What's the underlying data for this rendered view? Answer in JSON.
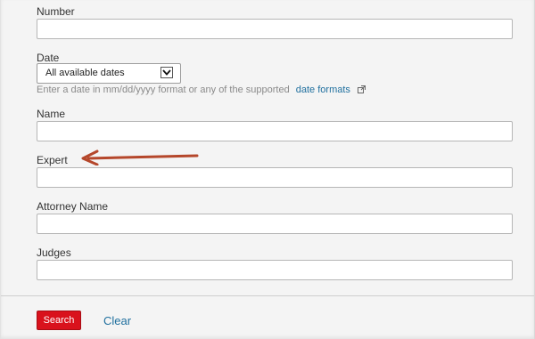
{
  "form": {
    "number": {
      "label": "Number",
      "value": ""
    },
    "date": {
      "label": "Date",
      "selected": "All available dates",
      "hint_text": "Enter a date in mm/dd/yyyy format or any of the supported",
      "hint_link": "date formats",
      "external_icon": "external-link-icon"
    },
    "name": {
      "label": "Name",
      "value": ""
    },
    "expert": {
      "label": "Expert",
      "value": ""
    },
    "attorney_name": {
      "label": "Attorney Name",
      "value": ""
    },
    "judges": {
      "label": "Judges",
      "value": ""
    }
  },
  "actions": {
    "search_label": "Search",
    "clear_label": "Clear"
  },
  "colors": {
    "search_button": "#d9121c",
    "link": "#1f6f9e",
    "annotation_arrow": "#b5472b"
  },
  "annotation": {
    "icon": "arrow-left-icon",
    "points_to": "Expert"
  }
}
